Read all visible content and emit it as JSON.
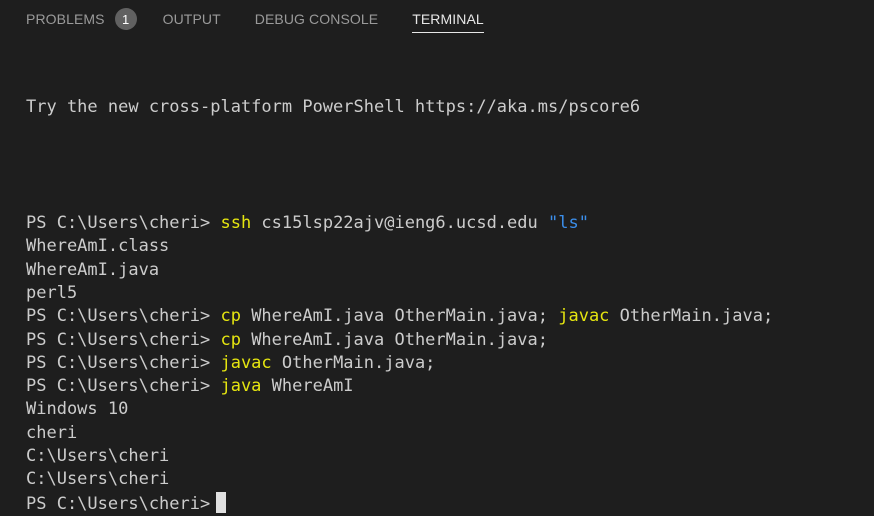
{
  "tabs": [
    {
      "label": "PROBLEMS",
      "badge": "1",
      "active": false
    },
    {
      "label": "OUTPUT",
      "active": false
    },
    {
      "label": "DEBUG CONSOLE",
      "active": false
    },
    {
      "label": "TERMINAL",
      "active": true
    }
  ],
  "colors": {
    "background": "#1e1e1e",
    "text": "#cccccc",
    "command": "#e5e510",
    "string": "#3b8eea",
    "tab_inactive": "#9a9a9a",
    "tab_active": "#e7e7e7",
    "badge_bg": "#616161"
  },
  "terminal": {
    "banner": "Try the new cross-platform PowerShell https://aka.ms/pscore6",
    "prompt": "PS C:\\Users\\cheri> ",
    "lines": [
      {
        "type": "cmd",
        "parts": [
          {
            "cls": "cmd",
            "text": "ssh"
          },
          {
            "cls": "",
            "text": " cs15lsp22ajv@ieng6.ucsd.edu "
          },
          {
            "cls": "str",
            "text": "\"ls\""
          }
        ]
      },
      {
        "type": "out",
        "text": "WhereAmI.class"
      },
      {
        "type": "out",
        "text": "WhereAmI.java"
      },
      {
        "type": "out",
        "text": "perl5"
      },
      {
        "type": "cmd",
        "parts": [
          {
            "cls": "cmd",
            "text": "cp"
          },
          {
            "cls": "",
            "text": " WhereAmI.java OtherMain.java; "
          },
          {
            "cls": "cmd",
            "text": "javac"
          },
          {
            "cls": "",
            "text": " OtherMain.java;"
          }
        ]
      },
      {
        "type": "cmd",
        "parts": [
          {
            "cls": "cmd",
            "text": "cp"
          },
          {
            "cls": "",
            "text": " WhereAmI.java OtherMain.java;"
          }
        ]
      },
      {
        "type": "cmd",
        "parts": [
          {
            "cls": "cmd",
            "text": "javac"
          },
          {
            "cls": "",
            "text": " OtherMain.java;"
          }
        ]
      },
      {
        "type": "cmd",
        "parts": [
          {
            "cls": "cmd",
            "text": "java"
          },
          {
            "cls": "",
            "text": " WhereAmI"
          }
        ]
      },
      {
        "type": "out",
        "text": "Windows 10"
      },
      {
        "type": "out",
        "text": "cheri"
      },
      {
        "type": "out",
        "text": "C:\\Users\\cheri"
      },
      {
        "type": "out",
        "text": "C:\\Users\\cheri"
      },
      {
        "type": "prompt_only"
      }
    ]
  }
}
